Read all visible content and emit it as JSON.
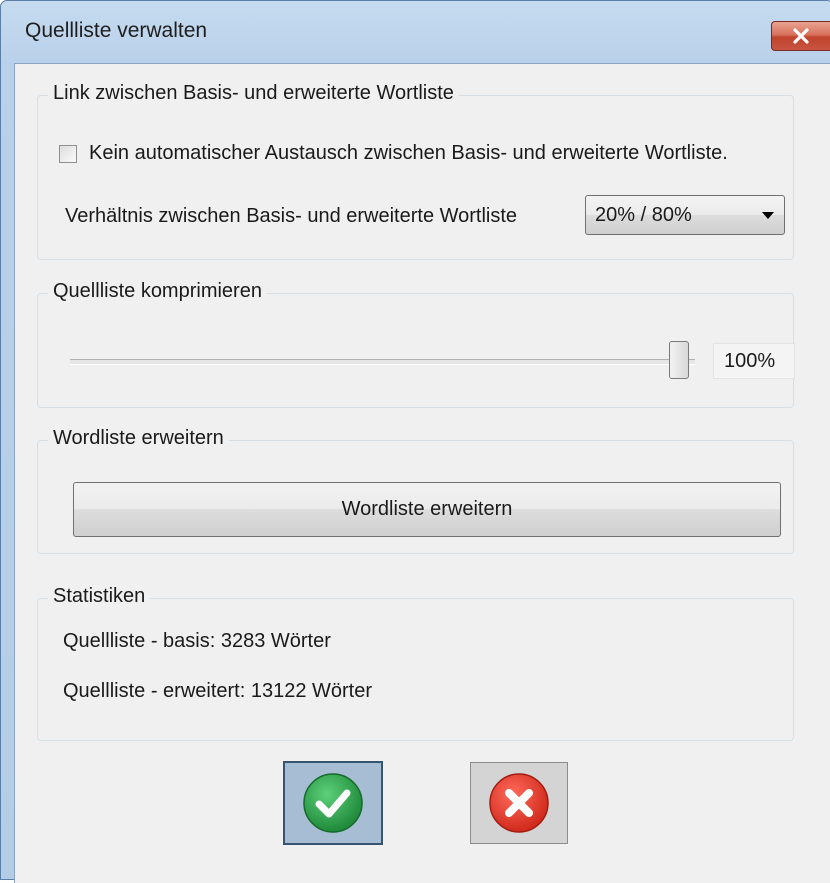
{
  "window": {
    "title": "Quellliste verwalten"
  },
  "link_group": {
    "legend": "Link zwischen Basis- und erweiterte Wortliste",
    "checkbox_label": "Kein automatischer Austausch zwischen Basis- und erweiterte Wortliste.",
    "checkbox_checked": false,
    "ratio_label": "Verhältnis zwischen Basis- und erweiterte Wortliste",
    "ratio_value": "20% / 80%"
  },
  "compress_group": {
    "legend": "Quellliste komprimieren",
    "slider_value": 1.0,
    "value_text": "100%"
  },
  "extend_group": {
    "legend": "Wordliste erweitern",
    "button_label": "Wordliste erweitern"
  },
  "stats_group": {
    "legend": "Statistiken",
    "basis": "Quellliste - basis: 3283 Wörter",
    "extended": "Quellliste - erweitert: 13122 Wörter"
  },
  "icons": {
    "ok": "checkmark-icon",
    "cancel": "x-icon",
    "close": "close-icon"
  },
  "colors": {
    "ok_green": "#2fa34a",
    "cancel_red": "#e63d2e",
    "close_red": "#c75542",
    "title_bg": "#b9d1ea"
  }
}
